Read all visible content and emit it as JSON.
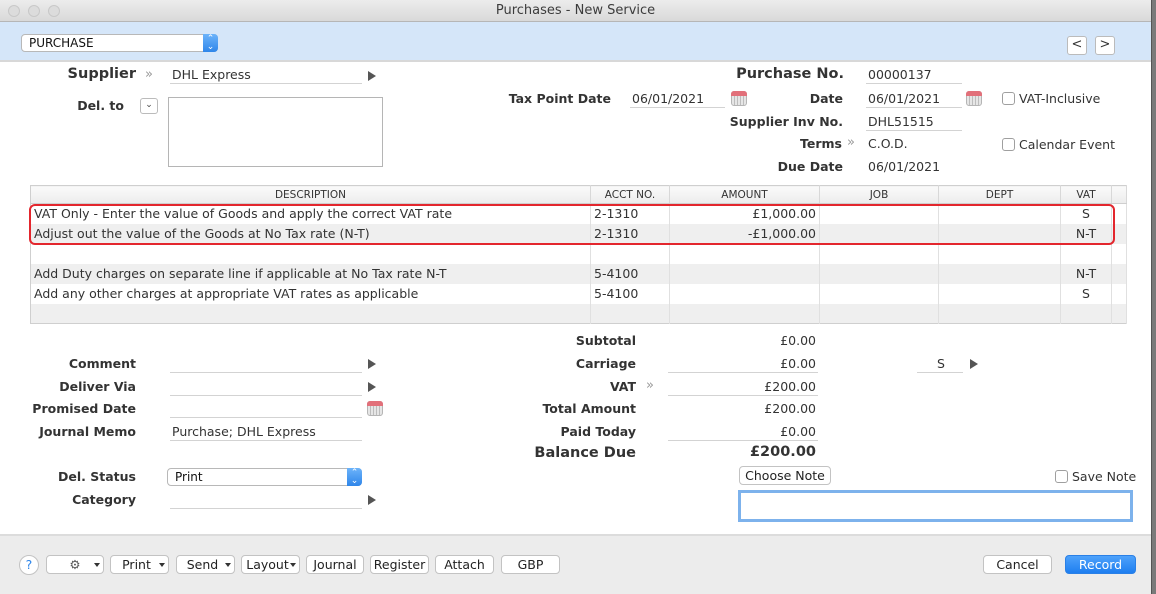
{
  "window": {
    "title": "Purchases - New Service"
  },
  "topbar": {
    "type_select": "PURCHASE",
    "prev_label": "<",
    "next_label": ">"
  },
  "header": {
    "supplier_label": "Supplier",
    "supplier_value": "DHL Express",
    "del_to_label": "Del. to",
    "del_to_value": "",
    "tax_point_date_label": "Tax Point Date",
    "tax_point_date_value": "06/01/2021",
    "purchase_no_label": "Purchase No.",
    "purchase_no_value": "00000137",
    "date_label": "Date",
    "date_value": "06/01/2021",
    "supplier_inv_label": "Supplier Inv No.",
    "supplier_inv_value": "DHL51515",
    "terms_label": "Terms",
    "terms_value": "C.O.D.",
    "due_date_label": "Due Date",
    "due_date_value": "06/01/2021",
    "vat_inclusive_label": "VAT-Inclusive",
    "vat_inclusive_checked": false,
    "calendar_event_label": "Calendar Event",
    "calendar_event_checked": false
  },
  "table": {
    "columns": [
      "DESCRIPTION",
      "ACCT NO.",
      "AMOUNT",
      "JOB",
      "DEPT",
      "VAT"
    ],
    "rows": [
      {
        "description": "VAT Only - Enter the value of Goods and apply the correct VAT rate",
        "acct": "2-1310",
        "amount": "£1,000.00",
        "job": "",
        "dept": "",
        "vat": "S"
      },
      {
        "description": "Adjust out the value of the Goods at No Tax rate (N-T)",
        "acct": "2-1310",
        "amount": "-£1,000.00",
        "job": "",
        "dept": "",
        "vat": "N-T"
      },
      {
        "description": "",
        "acct": "",
        "amount": "",
        "job": "",
        "dept": "",
        "vat": ""
      },
      {
        "description": "Add Duty charges on separate line if applicable at No Tax rate N-T",
        "acct": "5-4100",
        "amount": "",
        "job": "",
        "dept": "",
        "vat": "N-T"
      },
      {
        "description": "Add any other charges at appropriate VAT rates as applicable",
        "acct": "5-4100",
        "amount": "",
        "job": "",
        "dept": "",
        "vat": "S"
      },
      {
        "description": "",
        "acct": "",
        "amount": "",
        "job": "",
        "dept": "",
        "vat": ""
      }
    ]
  },
  "details": {
    "comment_label": "Comment",
    "comment_value": "",
    "deliver_via_label": "Deliver Via",
    "deliver_via_value": "",
    "promised_date_label": "Promised Date",
    "promised_date_value": "",
    "journal_memo_label": "Journal Memo",
    "journal_memo_value": "Purchase; DHL Express",
    "del_status_label": "Del. Status",
    "del_status_value": "Print",
    "category_label": "Category",
    "category_value": ""
  },
  "totals": {
    "subtotal_label": "Subtotal",
    "subtotal_value": "£0.00",
    "carriage_label": "Carriage",
    "carriage_value": "£0.00",
    "carriage_tax": "S",
    "vat_label": "VAT",
    "vat_value": "£200.00",
    "total_label": "Total Amount",
    "total_value": "£200.00",
    "paid_label": "Paid Today",
    "paid_value": "£0.00",
    "balance_label": "Balance Due",
    "balance_value": "£200.00"
  },
  "notes": {
    "choose_note_label": "Choose Note",
    "save_note_label": "Save Note",
    "save_note_checked": false,
    "note_value": ""
  },
  "footer": {
    "help_label": "?",
    "print_label": "Print",
    "send_label": "Send",
    "layout_label": "Layout",
    "journal_label": "Journal",
    "register_label": "Register",
    "attach_label": "Attach",
    "currency_label": "GBP",
    "cancel_label": "Cancel",
    "record_label": "Record"
  },
  "colors": {
    "accent": "#2f86ea",
    "topbar": "#d5e6f9",
    "highlight": "#e3262d"
  }
}
